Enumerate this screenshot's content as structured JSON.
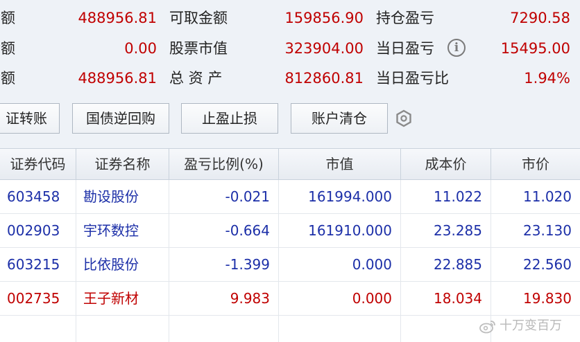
{
  "summary": {
    "col1": [
      {
        "label": "金额",
        "value": "488956.81"
      },
      {
        "label": "金额",
        "value": "0.00"
      },
      {
        "label": "金额",
        "value": "488956.81"
      }
    ],
    "col2": [
      {
        "label": "可取金额",
        "value": "159856.90"
      },
      {
        "label": "股票市值",
        "value": "323904.00"
      },
      {
        "label": "总 资 产",
        "value": "812860.81"
      }
    ],
    "col3": [
      {
        "label": "持仓盈亏",
        "value": "7290.58"
      },
      {
        "label": "当日盈亏",
        "value": "15495.00"
      },
      {
        "label": "当日盈亏比",
        "value": "1.94%"
      }
    ],
    "info_icon": "i"
  },
  "toolbar": {
    "buttons": [
      "证转账",
      "国债逆回购",
      "止盈止损",
      "账户清仓"
    ],
    "settings_icon": "hexagon-gear-icon"
  },
  "table": {
    "headers": [
      "证券代码",
      "证券名称",
      "盈亏比例(%)",
      "市值",
      "成本价",
      "市价"
    ],
    "rows": [
      {
        "code": "603458",
        "name": "勘设股份",
        "pnl_ratio": "-0.021",
        "market_value": "161994.000",
        "cost": "11.022",
        "price": "11.020",
        "color": "#1c2fa8"
      },
      {
        "code": "002903",
        "name": "宇环数控",
        "pnl_ratio": "-0.664",
        "market_value": "161910.000",
        "cost": "23.285",
        "price": "23.130",
        "color": "#1c2fa8"
      },
      {
        "code": "603215",
        "name": "比依股份",
        "pnl_ratio": "-1.399",
        "market_value": "0.000",
        "cost": "22.885",
        "price": "22.560",
        "color": "#1c2fa8"
      },
      {
        "code": "002735",
        "name": "王子新材",
        "pnl_ratio": "9.983",
        "market_value": "0.000",
        "cost": "18.034",
        "price": "19.830",
        "color": "#c00000"
      }
    ]
  },
  "watermark": {
    "text": "十万变百万",
    "icon": "weibo-icon"
  },
  "colors": {
    "positive": "#c00000",
    "negative": "#1c2fa8",
    "background": "#eef2f7"
  }
}
